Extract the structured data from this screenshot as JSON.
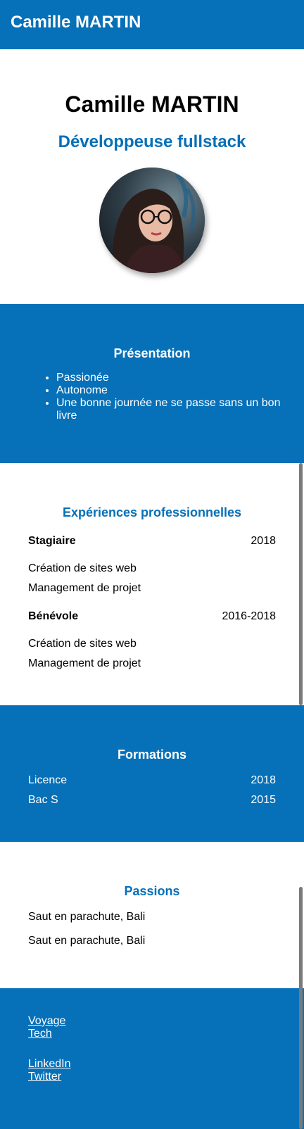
{
  "header": {
    "title": "Camille MARTIN"
  },
  "hero": {
    "name": "Camille MARTIN",
    "role": "Développeuse fullstack"
  },
  "presentation": {
    "title": "Présentation",
    "items": [
      "Passionée",
      "Autonome",
      "Une bonne journée ne se passe sans un bon livre"
    ]
  },
  "experiences": {
    "title": "Expériences professionnelles",
    "jobs": [
      {
        "title": "Stagiaire",
        "period": "2018",
        "tasks": [
          "Création de sites web",
          "Management de projet"
        ]
      },
      {
        "title": "Bénévole",
        "period": "2016-2018",
        "tasks": [
          "Création de sites web",
          "Management de projet"
        ]
      }
    ]
  },
  "formations": {
    "title": "Formations",
    "items": [
      {
        "name": "Licence",
        "year": "2018"
      },
      {
        "name": "Bac S",
        "year": "2015"
      }
    ]
  },
  "passions": {
    "title": "Passions",
    "items": [
      "Saut en parachute, Bali",
      "Saut en parachute, Bali"
    ]
  },
  "footer": {
    "links_group1": [
      "Voyage",
      "Tech"
    ],
    "links_group2": [
      "LinkedIn",
      "Twitter"
    ]
  },
  "colors": {
    "accent": "#0670b8",
    "background": "#ffffff",
    "text": "#000000"
  }
}
